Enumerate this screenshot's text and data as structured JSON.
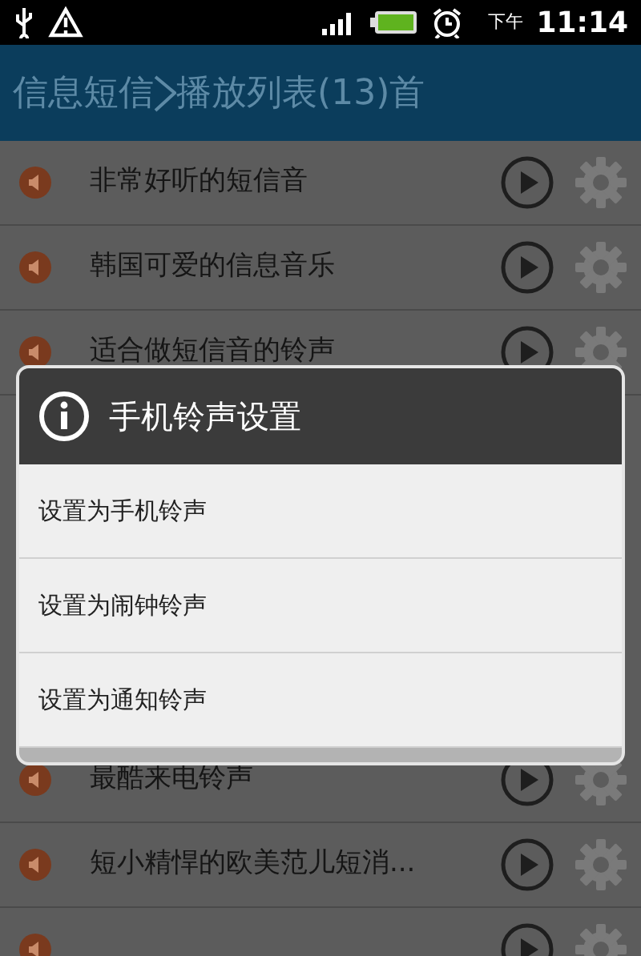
{
  "status_bar": {
    "period": "下午",
    "time": "11:14"
  },
  "title_bar": {
    "parent": "信息短信",
    "current": "播放列表(13)首"
  },
  "tracks": [
    {
      "kind": "song",
      "title": "非常好听的短信音"
    },
    {
      "kind": "song",
      "title": "韩国可爱的信息音乐"
    },
    {
      "kind": "song",
      "title": "适合做短信音的铃声"
    },
    {
      "kind": "song",
      "title": "最酷来电铃声"
    },
    {
      "kind": "song",
      "title": "短小精悍的欧美范儿短消..."
    },
    {
      "kind": "cut-off"
    }
  ],
  "dialog": {
    "title": "手机铃声设置",
    "options": [
      "设置为手机铃声",
      "设置为闹钟铃声",
      "设置为通知铃声"
    ]
  }
}
